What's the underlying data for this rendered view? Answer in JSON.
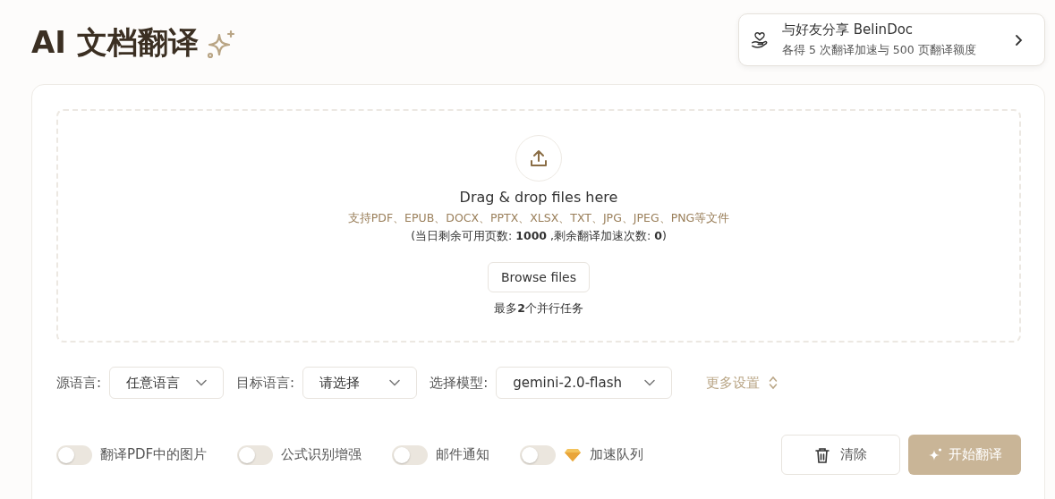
{
  "title": "AI 文档翻译",
  "share": {
    "title": "与好友分享 BelinDoc",
    "subtitle": "各得 5 次翻译加速与 500 页翻译额度"
  },
  "dropzone": {
    "heading": "Drag & drop files here",
    "formats": "支持PDF、EPUB、DOCX、PPTX、XLSX、TXT、JPG、JPEG、PNG等文件",
    "quota": "(当日剩余可用页数: **1000** ,剩余翻译加速次数: **0**)",
    "browse_button": "Browse files",
    "limit": "最多**2**个并行任务"
  },
  "selects": [
    {
      "label": "源语言:",
      "value": "任意语言"
    },
    {
      "label": "目标语言:",
      "value": "请选择"
    },
    {
      "label": "选择模型:",
      "value": "gemini-2.0-flash"
    }
  ],
  "more_settings": "更多设置",
  "toggles": [
    {
      "label": "翻译PDF中的图片",
      "on": false,
      "kind": "plain"
    },
    {
      "label": "公式识别增强",
      "on": false,
      "kind": "plain"
    },
    {
      "label": "邮件通知",
      "on": false,
      "kind": "plain"
    },
    {
      "label": "加速队列",
      "on": false,
      "kind": "premium"
    }
  ],
  "clear_button": "清除",
  "start_button": {
    "label": "开始翻译",
    "disabled": true
  }
}
